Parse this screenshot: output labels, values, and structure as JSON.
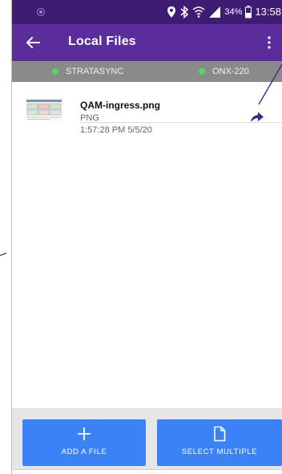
{
  "status_bar": {
    "battery": "34%",
    "time": "13:58",
    "icons": [
      "location-pin-icon",
      "bluetooth-icon",
      "wifi-icon",
      "cell-signal-icon",
      "battery-icon"
    ]
  },
  "app_bar": {
    "title": "Local Files",
    "back_icon": "arrow-left-icon",
    "menu_icon": "more-vertical-icon"
  },
  "devices": [
    {
      "label": "STRATASYNC",
      "status_color": "#4cd964"
    },
    {
      "label": "ONX-220",
      "status_color": "#4cd964"
    }
  ],
  "files": [
    {
      "name": "QAM-ingress.png",
      "type": "PNG",
      "date": "1:57:28 PM 5/5/20",
      "action_icon": "share-arrow-icon"
    }
  ],
  "actions": {
    "add_file": "ADD A FILE",
    "select_multiple": "SELECT MULTIPLE"
  },
  "colors": {
    "status_bar": "#3f1c73",
    "app_bar": "#5b2d9c",
    "device_bar": "#8a8a8a",
    "accent_button": "#3b82f6",
    "status_dot": "#4cd964"
  }
}
